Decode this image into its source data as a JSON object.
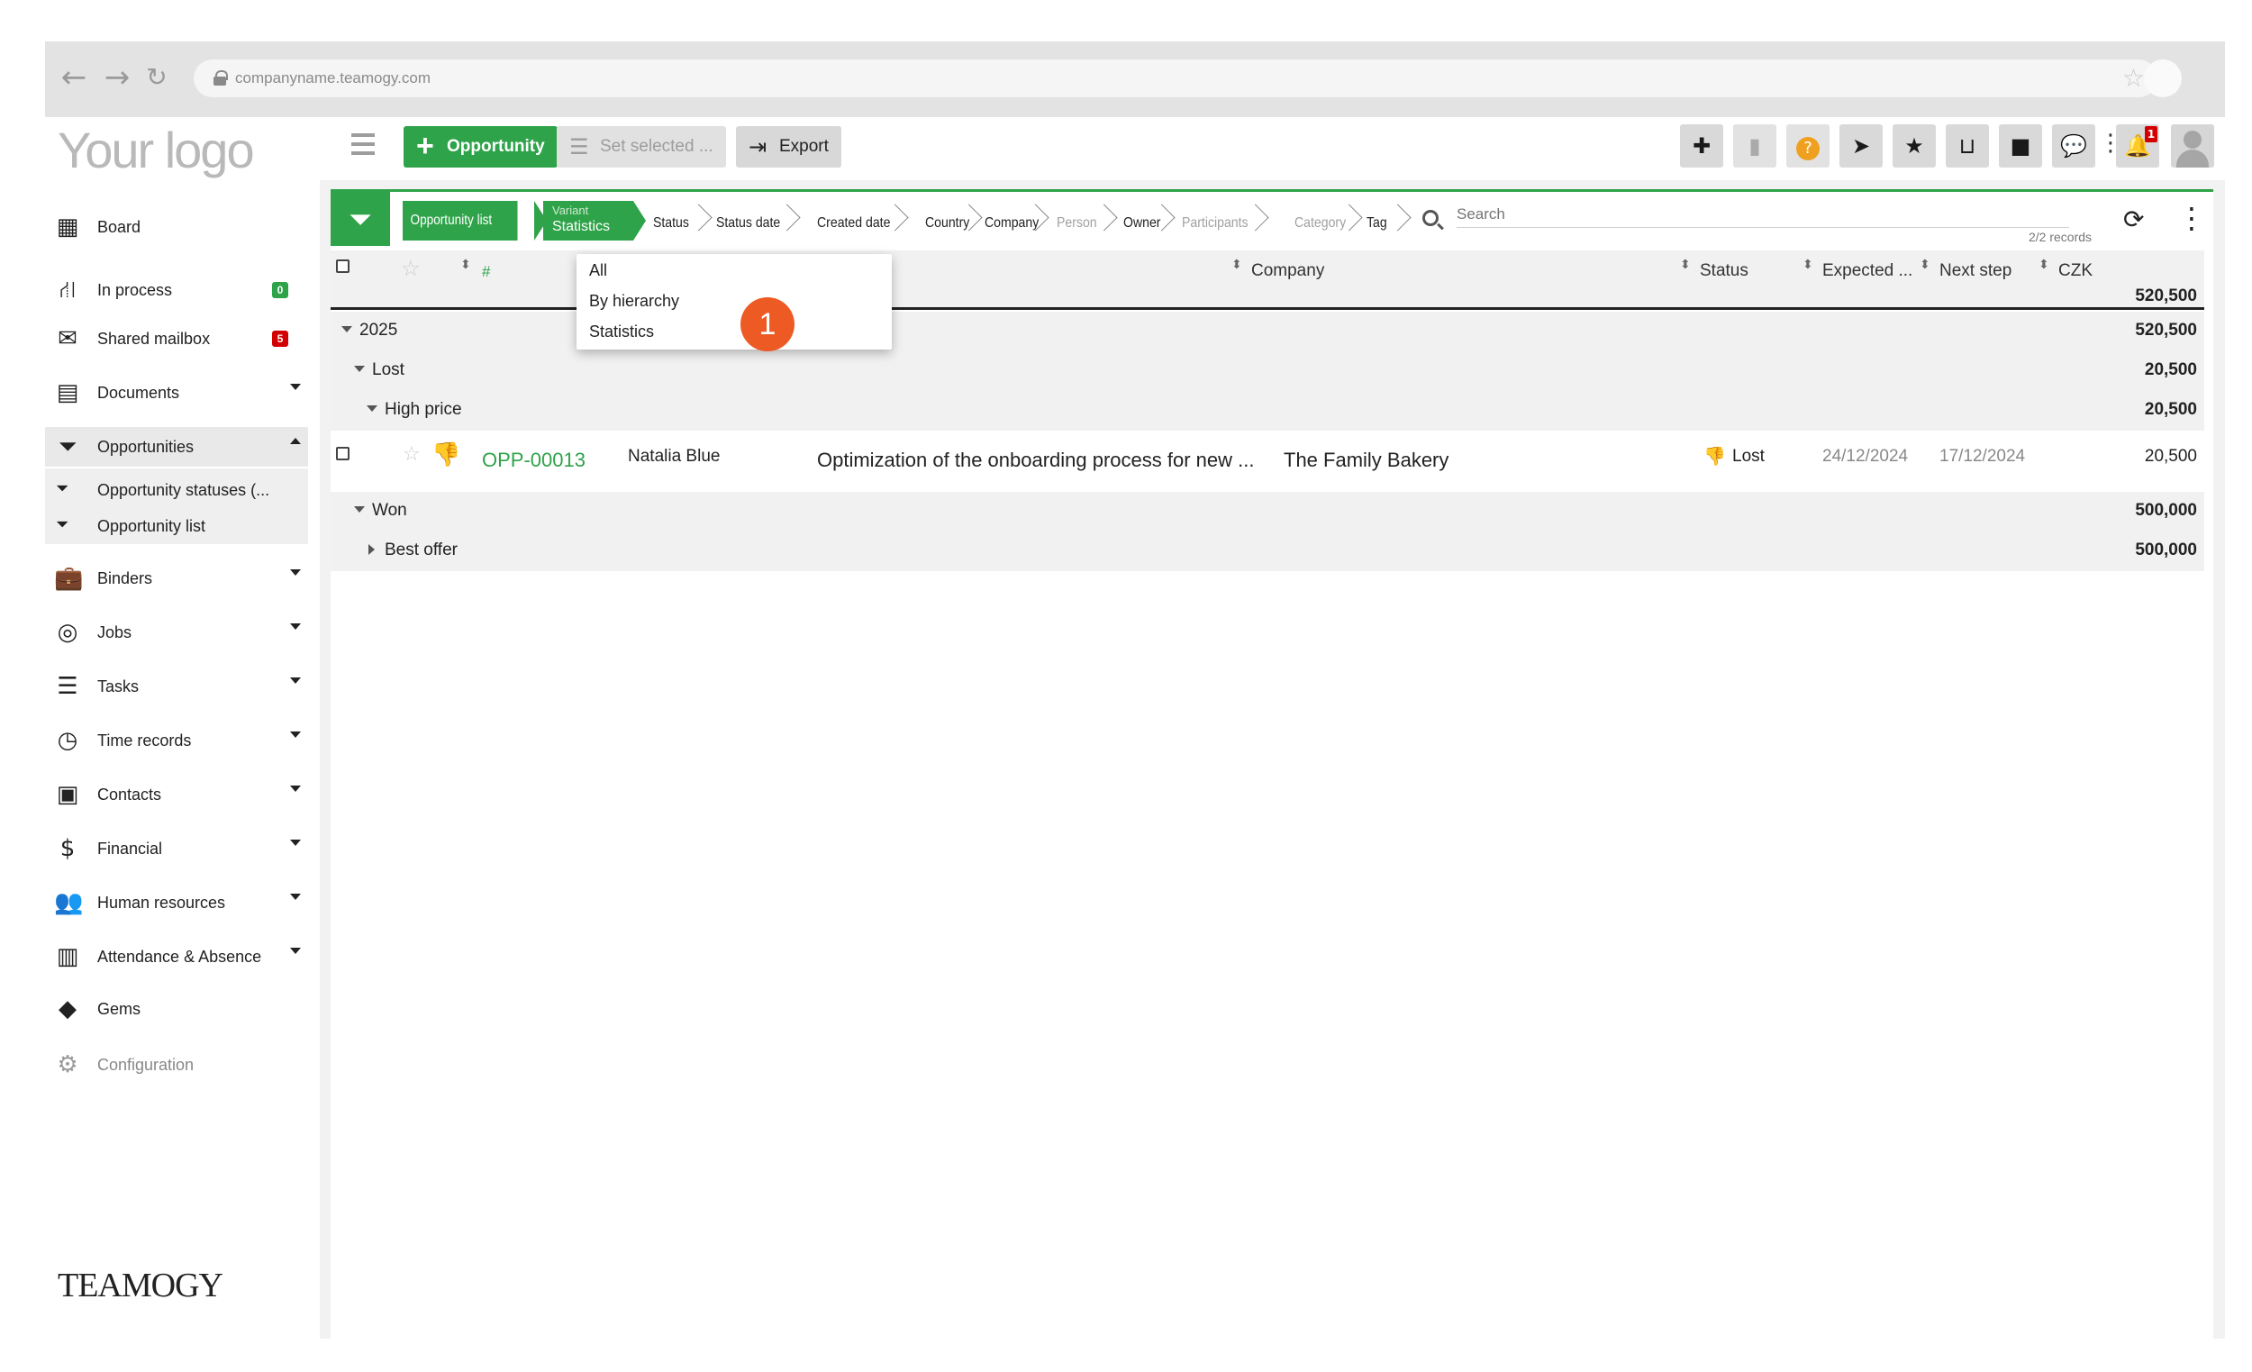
{
  "browser": {
    "url": "companyname.teamogy.com"
  },
  "logo": "Your logo",
  "toolbar": {
    "opportunity_label": "Opportunity",
    "set_selected_label": "Set selected ...",
    "export_label": "Export",
    "notification_count": "1"
  },
  "sidebar": {
    "items": [
      {
        "label": "Board",
        "icon": "board-icon"
      },
      {
        "label": "In process",
        "icon": "workflow-icon",
        "badge": "0",
        "badge_color": "#2fa34a"
      },
      {
        "label": "Shared mailbox",
        "icon": "envelope-icon",
        "badge": "5",
        "badge_color": "#d20000"
      },
      {
        "label": "Documents",
        "icon": "document-icon"
      },
      {
        "label": "Opportunities",
        "icon": "opportunities-icon"
      },
      {
        "label": "Binders",
        "icon": "briefcase-icon"
      },
      {
        "label": "Jobs",
        "icon": "target-icon"
      },
      {
        "label": "Tasks",
        "icon": "tasks-icon"
      },
      {
        "label": "Time records",
        "icon": "clock-icon"
      },
      {
        "label": "Contacts",
        "icon": "contact-card-icon"
      },
      {
        "label": "Financial",
        "icon": "dollar-icon"
      },
      {
        "label": "Human resources",
        "icon": "people-icon"
      },
      {
        "label": "Attendance & Absence",
        "icon": "building-icon"
      },
      {
        "label": "Gems",
        "icon": "gem-icon"
      },
      {
        "label": "Configuration",
        "icon": "gear-icon"
      }
    ],
    "sub_items": [
      {
        "label": "Opportunity statuses (..."
      },
      {
        "label": "Opportunity list"
      }
    ]
  },
  "brand": "TEAMOGY",
  "filterbar": {
    "list_label": "Opportunity list",
    "variant_small": "Variant",
    "variant_label": "Statistics",
    "crumbs": [
      "Status",
      "Status date",
      "Created date",
      "Country",
      "Company",
      "Person",
      "Owner",
      "Participants",
      "Category",
      "Tag"
    ],
    "search_placeholder": "Search",
    "records": "2/2 records"
  },
  "table": {
    "columns": {
      "hash": "#",
      "company": "Company",
      "status": "Status",
      "expected": "Expected ...",
      "next_step": "Next step",
      "currency": "CZK"
    },
    "grand_total": "520,500",
    "groups": [
      {
        "label": "2025",
        "total": "520,500"
      },
      {
        "label": "Lost",
        "total": "20,500"
      },
      {
        "label": "High price",
        "total": "20,500"
      },
      {
        "label": "Won",
        "total": "500,000"
      },
      {
        "label": "Best offer",
        "total": "500,000"
      }
    ],
    "row": {
      "id": "OPP-00013",
      "person": "Natalia Blue",
      "title": "Optimization of the onboarding process for new ...",
      "company": "The Family Bakery",
      "status": "Lost",
      "expected": "24/12/2024",
      "next_step": "17/12/2024",
      "amount": "20,500"
    }
  },
  "dropdown": {
    "items": [
      "All",
      "By hierarchy",
      "Statistics"
    ]
  },
  "callout": "1",
  "colors": {
    "accent": "#2fa34a",
    "callout": "#ee5a24",
    "badge_red": "#d20000"
  }
}
